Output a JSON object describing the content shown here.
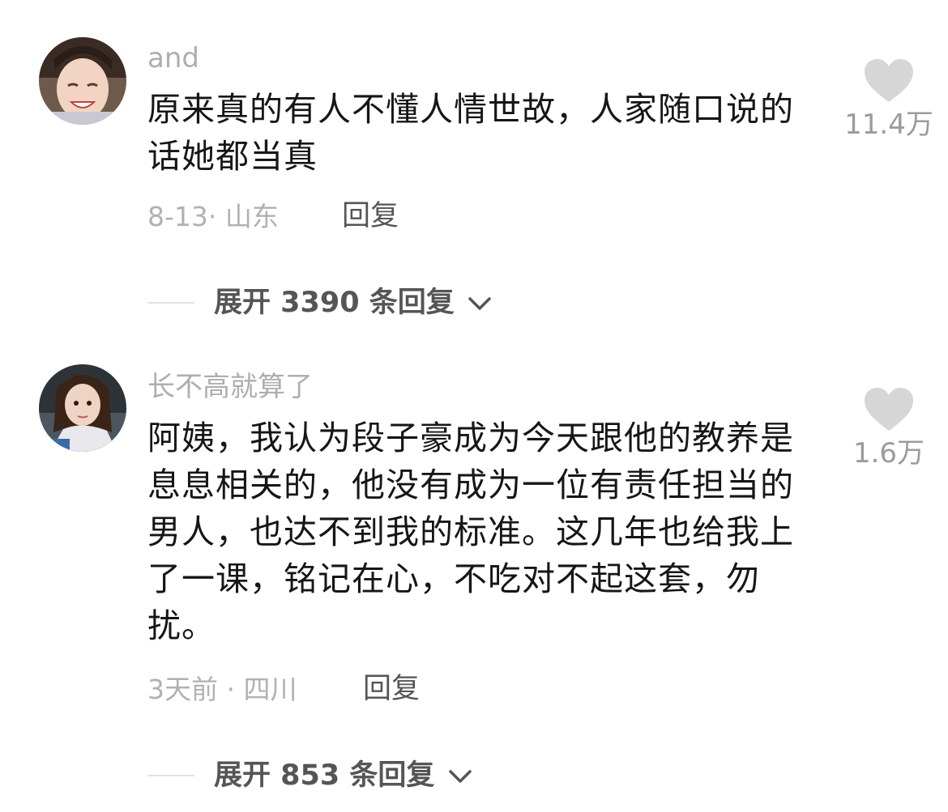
{
  "comments": [
    {
      "username": "and",
      "text": "原来真的有人不懂人情世故，人家随口说的话她都当真",
      "date": "8-13",
      "location": "山东",
      "meta_separator": "·",
      "reply_label": "回复",
      "like_count": "11.4万",
      "expand_label": "展开 3390 条回复",
      "avatar_icon": "user-avatar-photo"
    },
    {
      "username": "长不高就算了",
      "text": "阿姨，我认为段子豪成为今天跟他的教养是息息相关的，他没有成为一位有责任担当的男人，也达不到我的标准。这几年也给我上了一课，铭记在心，不吃对不起这套，勿扰。",
      "date": "3天前",
      "location": "四川",
      "meta_separator": "·",
      "reply_label": "回复",
      "like_count": "1.6万",
      "expand_label": "展开 853 条回复",
      "avatar_icon": "user-avatar-photo"
    }
  ],
  "colors": {
    "username": "#aeaeae",
    "body_text": "#161616",
    "meta": "#b1b1b1",
    "heart": "#d6d6d6",
    "action": "#555555"
  },
  "icons": {
    "like": "heart-icon",
    "expand": "chevron-down-icon"
  }
}
